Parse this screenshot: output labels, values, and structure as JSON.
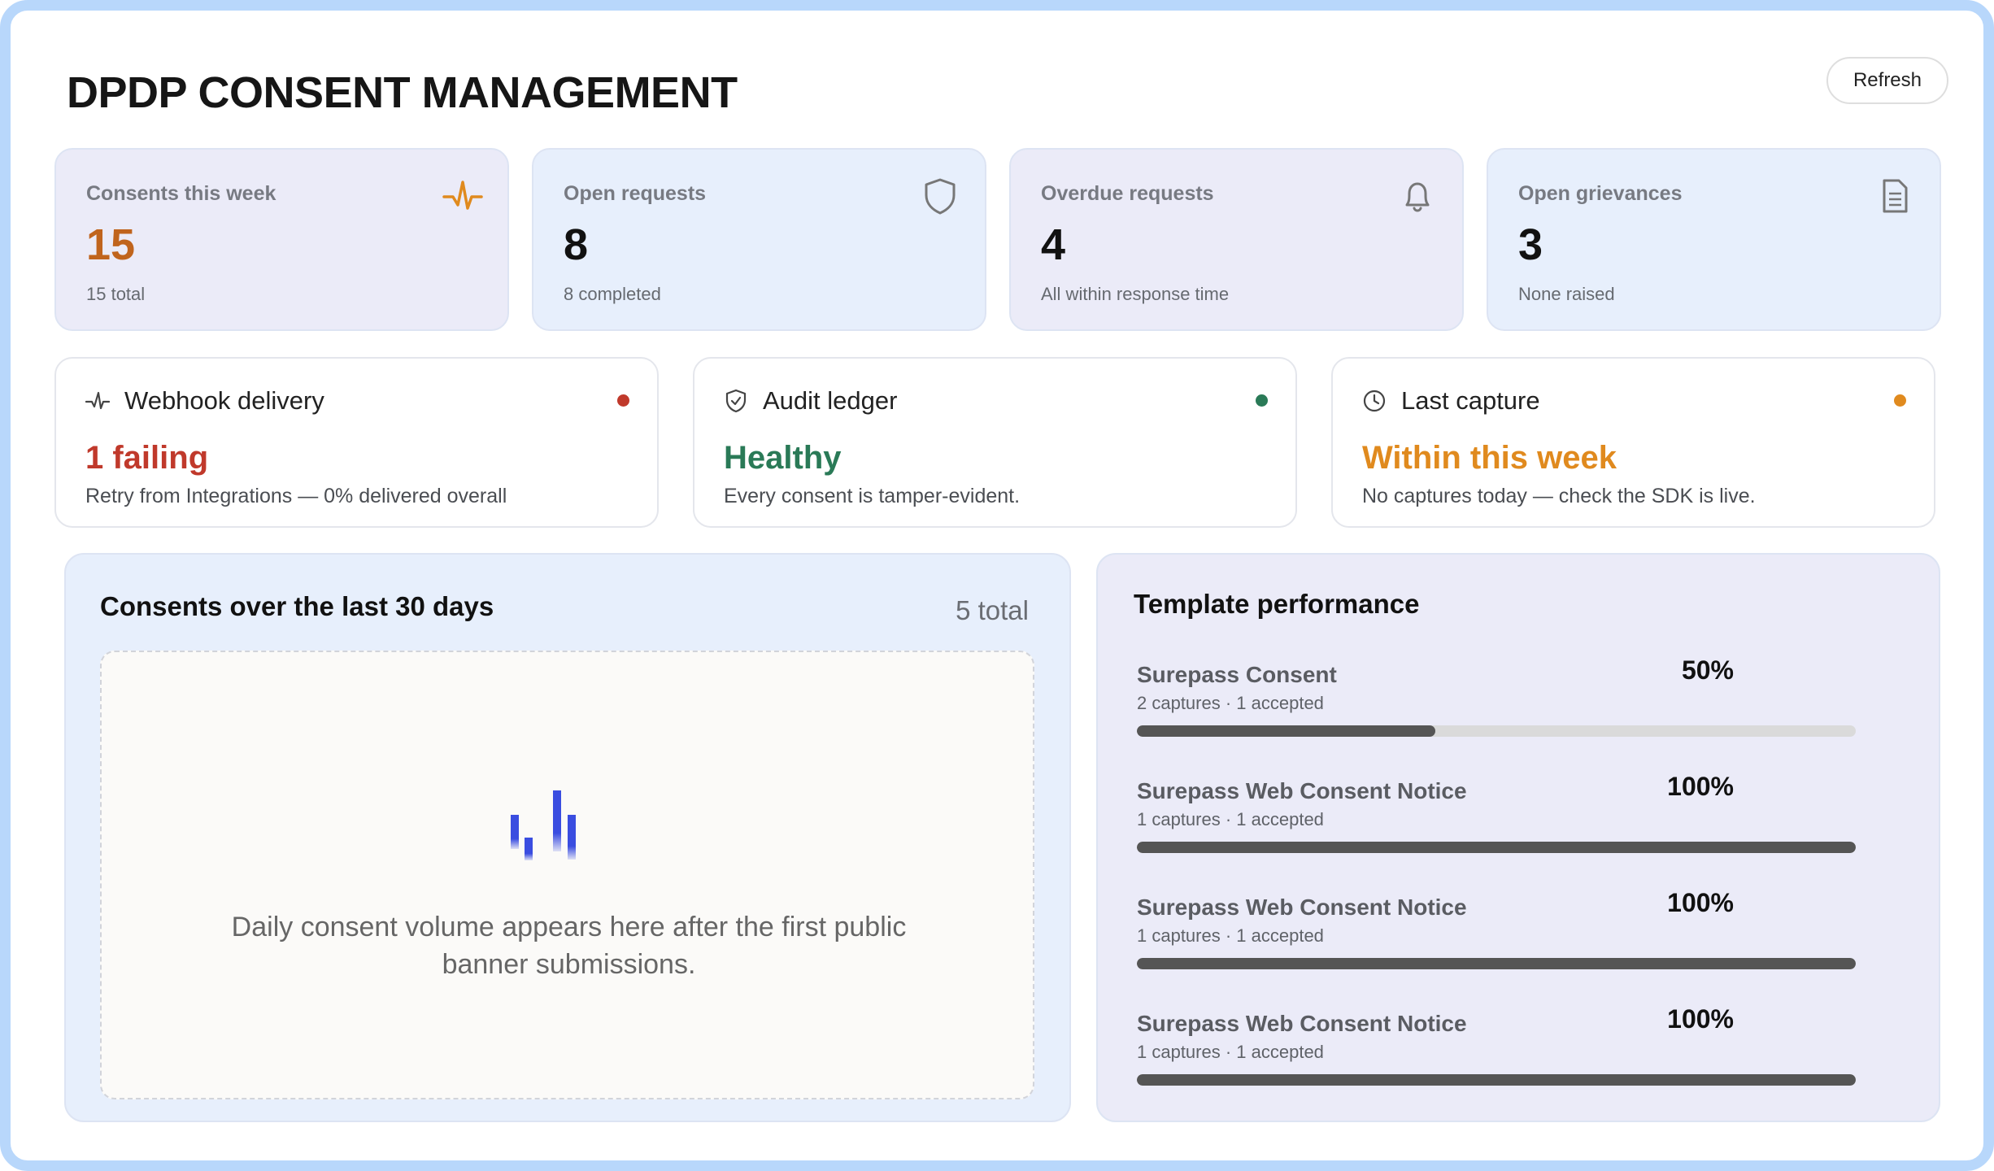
{
  "header": {
    "title": "DPDP CONSENT MANAGEMENT",
    "refresh_label": "Refresh"
  },
  "stats": [
    {
      "label": "Consents this week",
      "value": "15",
      "sub": "15 total",
      "icon": "pulse-icon",
      "accent": "#e08a1e"
    },
    {
      "label": "Open requests",
      "value": "8",
      "sub": "8 completed",
      "icon": "shield-icon"
    },
    {
      "label": "Overdue requests",
      "value": "4",
      "sub": "All within response time",
      "icon": "bell-icon"
    },
    {
      "label": "Open grievances",
      "value": "3",
      "sub": "None raised",
      "icon": "document-icon"
    }
  ],
  "status": [
    {
      "title": "Webhook delivery",
      "value": "1 failing",
      "desc": "Retry from Integrations — 0% delivered overall",
      "icon": "activity-icon",
      "color": "#c0392b"
    },
    {
      "title": "Audit ledger",
      "value": "Healthy",
      "desc": "Every consent is tamper-evident.",
      "icon": "shield-check-icon",
      "color": "#2a7a57"
    },
    {
      "title": "Last capture",
      "value": "Within this week",
      "desc": "No captures today — check the SDK is live.",
      "icon": "clock-icon",
      "color": "#e08a1e"
    }
  ],
  "consents_chart": {
    "title": "Consents over the last 30 days",
    "total": "5 total",
    "empty_message": "Daily consent volume appears here after the first public banner submissions."
  },
  "template_performance": {
    "title": "Template performance",
    "items": [
      {
        "name": "Surepass Consent",
        "meta": "2 captures · 1 accepted",
        "pct_label": "50%",
        "pct": 0.415
      },
      {
        "name": "Surepass Web Consent Notice",
        "meta": "1 captures · 1 accepted",
        "pct_label": "100%",
        "pct": 1.0
      },
      {
        "name": "Surepass Web Consent Notice",
        "meta": "1 captures · 1 accepted",
        "pct_label": "100%",
        "pct": 1.0
      },
      {
        "name": "Surepass Web Consent Notice",
        "meta": "1 captures · 1 accepted",
        "pct_label": "100%",
        "pct": 1.0
      }
    ]
  }
}
